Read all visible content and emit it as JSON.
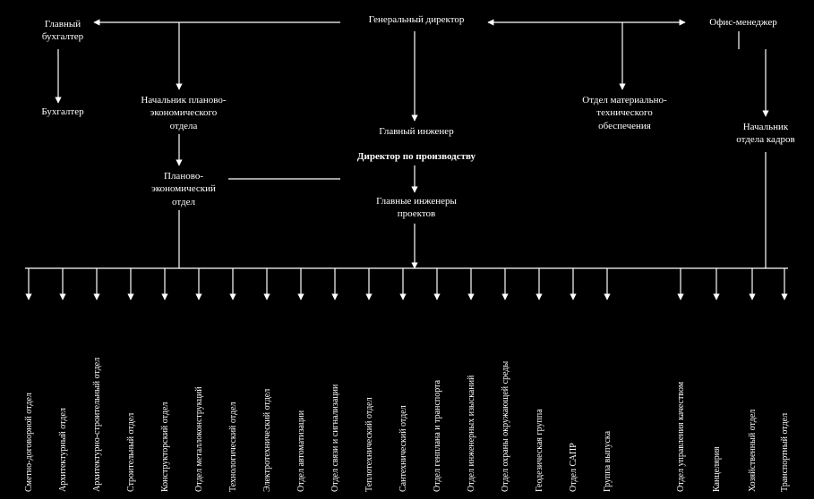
{
  "top": {
    "general_director": "Генеральный директор",
    "chief_accountant": "Главный\nбухгалтер",
    "office_manager": "Офис-менеджер",
    "accountant": "Бухгалтер",
    "head_plan_econ": "Начальник планово-\nэкономического\nотдела",
    "chief_engineer": "Главный инженер",
    "production_director": "Директор по производству",
    "supply_dept": "Отдел материально-\nтехнического\nобеспечения",
    "hr_head": "Начальник\nотдела кадров",
    "plan_econ_dept": "Планово-\nэкономический\nотдел",
    "chief_project_engineers": "Главные инженеры\nпроектов"
  },
  "bottom": [
    "Сметно-договорной отдел",
    "Архитектурный отдел",
    "Архитектурно-строительный отдел",
    "Строительный отдел",
    "Конструкторский отдел",
    "Отдел металлоконструкций",
    "Технологический отдел",
    "Электротехнический отдел",
    "Отдел автоматизации",
    "Отдел связи и сигнализации",
    "Теплотехнический отдел",
    "Сантехнический отдел",
    "Отдел генплана и транспорта",
    "Отдел инженерных изысканий",
    "Отдел охраны окружающей среды",
    "Геодезическая группа",
    "Отдел САПР",
    "Группа выпуска",
    "Отдел управления качеством",
    "Канцелярия",
    "Хозяйственный отдел",
    "Транспортный отдел"
  ]
}
